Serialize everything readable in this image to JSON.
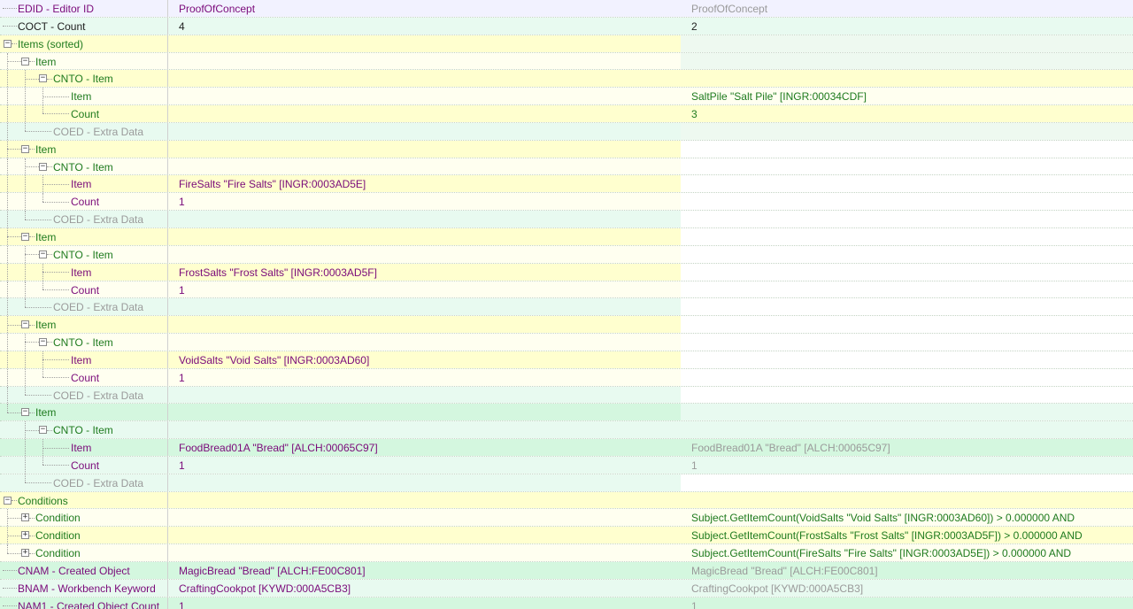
{
  "rows": [
    {
      "label": "EDID - Editor ID",
      "depth": 0,
      "toggle": "none",
      "label_color": "#7a0a7a",
      "bg0": "#f2f2ff",
      "v1": "ProofOfConcept",
      "v1_color": "#7a0a7a",
      "bg1": "#f2f2ff",
      "v2": "ProofOfConcept",
      "v2_color": "#9a9a9a",
      "bg2": "#f2f2ff"
    },
    {
      "label": "COCT - Count",
      "depth": 0,
      "toggle": "none",
      "label_color": "#202020",
      "bg0": "#e8faf0",
      "v1": "4",
      "v1_color": "#202020",
      "bg1": "#e8faf0",
      "v2": "2",
      "v2_color": "#202020",
      "bg2": "#e8faf0"
    },
    {
      "label": "Items (sorted)",
      "depth": 0,
      "toggle": "minus",
      "label_color": "#1e7a1e",
      "bg0": "#ffffcf",
      "v1": "",
      "v1_color": "#202020",
      "bg1": "#ffffcf",
      "v2": "",
      "v2_color": "#202020",
      "bg2": "#eef9f0"
    },
    {
      "label": "Item",
      "depth": 1,
      "toggle": "minus",
      "label_color": "#1e7a1e",
      "bg0": "#fffff0",
      "v1": "",
      "v1_color": "#202020",
      "bg1": "#fffff0",
      "v2": "",
      "v2_color": "#202020",
      "bg2": "#eef9f0"
    },
    {
      "label": "CNTO - Item",
      "depth": 2,
      "toggle": "minus",
      "label_color": "#1e7a1e",
      "bg0": "#ffffcf",
      "v1": "",
      "v1_color": "#202020",
      "bg1": "#ffffcf",
      "v2": "",
      "v2_color": "#202020",
      "bg2": "#ffffcf"
    },
    {
      "label": "Item",
      "depth": 3,
      "toggle": "none",
      "label_color": "#1e7a1e",
      "bg0": "#fffff0",
      "v1": "",
      "v1_color": "#202020",
      "bg1": "#fffff0",
      "v2": "SaltPile \"Salt Pile\" [INGR:00034CDF]",
      "v2_color": "#1e7a1e",
      "bg2": "#fffff0"
    },
    {
      "label": "Count",
      "depth": 3,
      "toggle": "none",
      "label_color": "#1e7a1e",
      "bg0": "#ffffcf",
      "v1": "",
      "v1_color": "#202020",
      "bg1": "#ffffcf",
      "v2": "3",
      "v2_color": "#1e7a1e",
      "bg2": "#ffffcf"
    },
    {
      "label": "COED - Extra Data",
      "depth": 2,
      "toggle": "none",
      "label_color": "#9a9a9a",
      "bg0": "#e8faf0",
      "v1": "",
      "v1_color": "#202020",
      "bg1": "#e8faf0",
      "v2": "",
      "v2_color": "#202020",
      "bg2": "#eef9f0"
    },
    {
      "label": "Item",
      "depth": 1,
      "toggle": "minus",
      "label_color": "#1e7a1e",
      "bg0": "#ffffcf",
      "v1": "",
      "v1_color": "#202020",
      "bg1": "#ffffcf",
      "v2": "",
      "v2_color": "#202020",
      "bg2": "#ffffff"
    },
    {
      "label": "CNTO - Item",
      "depth": 2,
      "toggle": "minus",
      "label_color": "#1e7a1e",
      "bg0": "#fffff0",
      "v1": "",
      "v1_color": "#202020",
      "bg1": "#fffff0",
      "v2": "",
      "v2_color": "#202020",
      "bg2": "#ffffff"
    },
    {
      "label": "Item",
      "depth": 3,
      "toggle": "none",
      "label_color": "#7a0a7a",
      "bg0": "#ffffcf",
      "v1": "FireSalts \"Fire Salts\" [INGR:0003AD5E]",
      "v1_color": "#7a0a7a",
      "bg1": "#ffffcf",
      "v2": "",
      "v2_color": "#202020",
      "bg2": "#ffffff"
    },
    {
      "label": "Count",
      "depth": 3,
      "toggle": "none",
      "label_color": "#7a0a7a",
      "bg0": "#fffff0",
      "v1": "1",
      "v1_color": "#7a0a7a",
      "bg1": "#fffff0",
      "v2": "",
      "v2_color": "#202020",
      "bg2": "#ffffff"
    },
    {
      "label": "COED - Extra Data",
      "depth": 2,
      "toggle": "none",
      "label_color": "#9a9a9a",
      "bg0": "#e8faf0",
      "v1": "",
      "v1_color": "#202020",
      "bg1": "#e8faf0",
      "v2": "",
      "v2_color": "#202020",
      "bg2": "#ffffff"
    },
    {
      "label": "Item",
      "depth": 1,
      "toggle": "minus",
      "label_color": "#1e7a1e",
      "bg0": "#ffffcf",
      "v1": "",
      "v1_color": "#202020",
      "bg1": "#ffffcf",
      "v2": "",
      "v2_color": "#202020",
      "bg2": "#ffffff"
    },
    {
      "label": "CNTO - Item",
      "depth": 2,
      "toggle": "minus",
      "label_color": "#1e7a1e",
      "bg0": "#fffff0",
      "v1": "",
      "v1_color": "#202020",
      "bg1": "#fffff0",
      "v2": "",
      "v2_color": "#202020",
      "bg2": "#ffffff"
    },
    {
      "label": "Item",
      "depth": 3,
      "toggle": "none",
      "label_color": "#7a0a7a",
      "bg0": "#ffffcf",
      "v1": "FrostSalts \"Frost Salts\" [INGR:0003AD5F]",
      "v1_color": "#7a0a7a",
      "bg1": "#ffffcf",
      "v2": "",
      "v2_color": "#202020",
      "bg2": "#ffffff"
    },
    {
      "label": "Count",
      "depth": 3,
      "toggle": "none",
      "label_color": "#7a0a7a",
      "bg0": "#fffff0",
      "v1": "1",
      "v1_color": "#7a0a7a",
      "bg1": "#fffff0",
      "v2": "",
      "v2_color": "#202020",
      "bg2": "#ffffff"
    },
    {
      "label": "COED - Extra Data",
      "depth": 2,
      "toggle": "none",
      "label_color": "#9a9a9a",
      "bg0": "#e8faf0",
      "v1": "",
      "v1_color": "#202020",
      "bg1": "#e8faf0",
      "v2": "",
      "v2_color": "#202020",
      "bg2": "#ffffff"
    },
    {
      "label": "Item",
      "depth": 1,
      "toggle": "minus",
      "label_color": "#1e7a1e",
      "bg0": "#ffffcf",
      "v1": "",
      "v1_color": "#202020",
      "bg1": "#ffffcf",
      "v2": "",
      "v2_color": "#202020",
      "bg2": "#ffffff"
    },
    {
      "label": "CNTO - Item",
      "depth": 2,
      "toggle": "minus",
      "label_color": "#1e7a1e",
      "bg0": "#fffff0",
      "v1": "",
      "v1_color": "#202020",
      "bg1": "#fffff0",
      "v2": "",
      "v2_color": "#202020",
      "bg2": "#ffffff"
    },
    {
      "label": "Item",
      "depth": 3,
      "toggle": "none",
      "label_color": "#7a0a7a",
      "bg0": "#ffffcf",
      "v1": "VoidSalts \"Void Salts\" [INGR:0003AD60]",
      "v1_color": "#7a0a7a",
      "bg1": "#ffffcf",
      "v2": "",
      "v2_color": "#202020",
      "bg2": "#ffffff"
    },
    {
      "label": "Count",
      "depth": 3,
      "toggle": "none",
      "label_color": "#7a0a7a",
      "bg0": "#fffff0",
      "v1": "1",
      "v1_color": "#7a0a7a",
      "bg1": "#fffff0",
      "v2": "",
      "v2_color": "#202020",
      "bg2": "#ffffff"
    },
    {
      "label": "COED - Extra Data",
      "depth": 2,
      "toggle": "none",
      "label_color": "#9a9a9a",
      "bg0": "#e8faf0",
      "v1": "",
      "v1_color": "#202020",
      "bg1": "#e8faf0",
      "v2": "",
      "v2_color": "#202020",
      "bg2": "#ffffff"
    },
    {
      "label": "Item",
      "depth": 1,
      "toggle": "minus",
      "label_color": "#1e7a1e",
      "bg0": "#d4f7df",
      "v1": "",
      "v1_color": "#202020",
      "bg1": "#d4f7df",
      "v2": "",
      "v2_color": "#202020",
      "bg2": "#e8faf0"
    },
    {
      "label": "CNTO - Item",
      "depth": 2,
      "toggle": "minus",
      "label_color": "#1e7a1e",
      "bg0": "#e8faf0",
      "v1": "",
      "v1_color": "#202020",
      "bg1": "#e8faf0",
      "v2": "",
      "v2_color": "#202020",
      "bg2": "#e8faf0"
    },
    {
      "label": "Item",
      "depth": 3,
      "toggle": "none",
      "label_color": "#7a0a7a",
      "bg0": "#d4f7df",
      "v1": "FoodBread01A \"Bread\" [ALCH:00065C97]",
      "v1_color": "#7a0a7a",
      "bg1": "#d4f7df",
      "v2": "FoodBread01A \"Bread\" [ALCH:00065C97]",
      "v2_color": "#9a9a9a",
      "bg2": "#d4f7df"
    },
    {
      "label": "Count",
      "depth": 3,
      "toggle": "none",
      "label_color": "#7a0a7a",
      "bg0": "#e8faf0",
      "v1": "1",
      "v1_color": "#7a0a7a",
      "bg1": "#e8faf0",
      "v2": "1",
      "v2_color": "#9a9a9a",
      "bg2": "#e8faf0"
    },
    {
      "label": "COED - Extra Data",
      "depth": 2,
      "toggle": "none",
      "label_color": "#9a9a9a",
      "bg0": "#e8faf0",
      "v1": "",
      "v1_color": "#202020",
      "bg1": "#e8faf0",
      "v2": "",
      "v2_color": "#202020",
      "bg2": "#ffffff"
    },
    {
      "label": "Conditions",
      "depth": 0,
      "toggle": "minus",
      "label_color": "#1e7a1e",
      "bg0": "#ffffcf",
      "v1": "",
      "v1_color": "#202020",
      "bg1": "#ffffcf",
      "v2": "",
      "v2_color": "#202020",
      "bg2": "#ffffcf"
    },
    {
      "label": "Condition",
      "depth": 1,
      "toggle": "plus",
      "label_color": "#1e7a1e",
      "bg0": "#fffff0",
      "v1": "",
      "v1_color": "#202020",
      "bg1": "#fffff0",
      "v2": "Subject.GetItemCount(VoidSalts \"Void Salts\" [INGR:0003AD60]) > 0.000000 AND",
      "v2_color": "#1e7a1e",
      "bg2": "#fffff0"
    },
    {
      "label": "Condition",
      "depth": 1,
      "toggle": "plus",
      "label_color": "#1e7a1e",
      "bg0": "#ffffcf",
      "v1": "",
      "v1_color": "#202020",
      "bg1": "#ffffcf",
      "v2": "Subject.GetItemCount(FrostSalts \"Frost Salts\" [INGR:0003AD5F]) > 0.000000 AND",
      "v2_color": "#1e7a1e",
      "bg2": "#ffffcf"
    },
    {
      "label": "Condition",
      "depth": 1,
      "toggle": "plus",
      "label_color": "#1e7a1e",
      "bg0": "#fffff0",
      "v1": "",
      "v1_color": "#202020",
      "bg1": "#fffff0",
      "v2": "Subject.GetItemCount(FireSalts \"Fire Salts\" [INGR:0003AD5E]) > 0.000000 AND",
      "v2_color": "#1e7a1e",
      "bg2": "#fffff0"
    },
    {
      "label": "CNAM - Created Object",
      "depth": 0,
      "toggle": "none",
      "label_color": "#7a0a7a",
      "bg0": "#d4f7df",
      "v1": "MagicBread \"Bread\" [ALCH:FE00C801]",
      "v1_color": "#7a0a7a",
      "bg1": "#d4f7df",
      "v2": "MagicBread \"Bread\" [ALCH:FE00C801]",
      "v2_color": "#9a9a9a",
      "bg2": "#d4f7df"
    },
    {
      "label": "BNAM - Workbench Keyword",
      "depth": 0,
      "toggle": "none",
      "label_color": "#7a0a7a",
      "bg0": "#e8faf0",
      "v1": "CraftingCookpot [KYWD:000A5CB3]",
      "v1_color": "#7a0a7a",
      "bg1": "#e8faf0",
      "v2": "CraftingCookpot [KYWD:000A5CB3]",
      "v2_color": "#9a9a9a",
      "bg2": "#e8faf0"
    },
    {
      "label": "NAM1 - Created Object Count",
      "depth": 0,
      "toggle": "none",
      "label_color": "#7a0a7a",
      "bg0": "#d4f7df",
      "v1": "1",
      "v1_color": "#7a0a7a",
      "bg1": "#d4f7df",
      "v2": "1",
      "v2_color": "#9a9a9a",
      "bg2": "#d4f7df"
    }
  ]
}
